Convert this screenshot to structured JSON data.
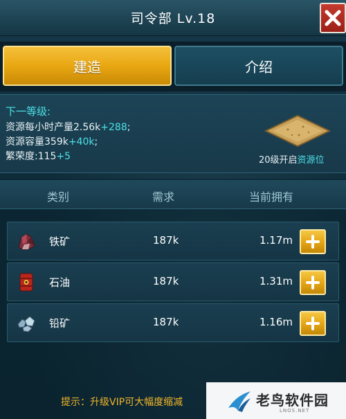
{
  "header": {
    "title": "司令部 Lv.18",
    "close_icon": "close-icon"
  },
  "tabs": {
    "build_label": "建造",
    "intro_label": "介绍",
    "active": "建造"
  },
  "next_level": {
    "heading": "下一等级:",
    "rate_label": "资源每小时产量2.56k",
    "rate_inc": "+288",
    "rate_suffix": ";",
    "capacity_label": "资源容量359k",
    "capacity_inc": "+40k",
    "capacity_suffix": ";",
    "prosperity_label": "繁荣度:115",
    "prosperity_inc": "+5",
    "unlock_prefix": "20级开启",
    "unlock_highlight": "资源位"
  },
  "table": {
    "headers": [
      "类别",
      "需求",
      "当前拥有"
    ],
    "rows": [
      {
        "icon": "iron-ore-icon",
        "name": "铁矿",
        "need": "187k",
        "have": "1.17m"
      },
      {
        "icon": "oil-barrel-icon",
        "name": "石油",
        "need": "187k",
        "have": "1.31m"
      },
      {
        "icon": "lead-ore-icon",
        "name": "铅矿",
        "need": "187k",
        "have": "1.16m"
      }
    ]
  },
  "tip": "提示：升级VIP可大幅度缩减",
  "watermark": {
    "text": "老鸟软件园",
    "sub": "LNOS.NET"
  },
  "colors": {
    "accent_gold": "#e9a712",
    "accent_cyan": "#4de0e6",
    "close_red": "#c43a2e",
    "tip_orange": "#f1b52a"
  }
}
